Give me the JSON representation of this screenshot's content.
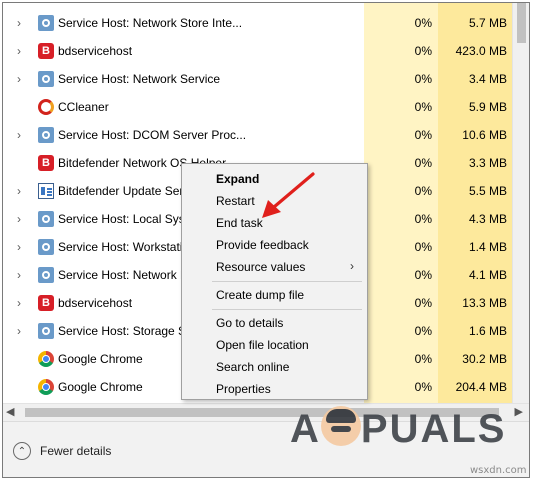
{
  "processes": [
    {
      "name": "Service Host: Network Store Inte...",
      "icon": "service-host-gear-icon",
      "expandable": true,
      "cpu": "0%",
      "memory": "5.7 MB"
    },
    {
      "name": "bdservicehost",
      "icon": "bitdefender-icon",
      "expandable": true,
      "cpu": "0%",
      "memory": "423.0 MB"
    },
    {
      "name": "Service Host: Network Service",
      "icon": "service-host-gear-icon",
      "expandable": true,
      "cpu": "0%",
      "memory": "3.4 MB"
    },
    {
      "name": "CCleaner",
      "icon": "ccleaner-icon",
      "expandable": false,
      "cpu": "0%",
      "memory": "5.9 MB"
    },
    {
      "name": "Service Host: DCOM Server Proc...",
      "icon": "service-host-gear-icon",
      "expandable": true,
      "cpu": "0%",
      "memory": "10.6 MB"
    },
    {
      "name": "Bitdefender Network OS Helper",
      "icon": "bitdefender-icon",
      "expandable": false,
      "cpu": "0%",
      "memory": "3.3 MB"
    },
    {
      "name": "Bitdefender Update Serv",
      "icon": "bitdefender-update-icon",
      "expandable": true,
      "cpu": "0%",
      "memory": "5.5 MB"
    },
    {
      "name": "Service Host: Local Syst",
      "icon": "service-host-gear-icon",
      "expandable": true,
      "cpu": "0%",
      "memory": "4.3 MB"
    },
    {
      "name": "Service Host: Workstatio",
      "icon": "service-host-gear-icon",
      "expandable": true,
      "cpu": "0%",
      "memory": "1.4 MB"
    },
    {
      "name": "Service Host: Network L",
      "icon": "service-host-gear-icon",
      "expandable": true,
      "cpu": "0%",
      "memory": "4.1 MB"
    },
    {
      "name": "bdservicehost",
      "icon": "bitdefender-icon",
      "expandable": true,
      "cpu": "0%",
      "memory": "13.3 MB"
    },
    {
      "name": "Service Host: Storage Se",
      "icon": "service-host-gear-icon",
      "expandable": true,
      "cpu": "0%",
      "memory": "1.6 MB"
    },
    {
      "name": "Google Chrome",
      "icon": "chrome-icon",
      "expandable": false,
      "cpu": "0%",
      "memory": "30.2 MB"
    },
    {
      "name": "Google Chrome",
      "icon": "chrome-icon",
      "expandable": false,
      "cpu": "0%",
      "memory": "204.4 MB"
    }
  ],
  "context_menu": {
    "items": [
      {
        "label": "Expand",
        "bold": true,
        "submenu": false
      },
      {
        "label": "Restart",
        "bold": false,
        "submenu": false
      },
      {
        "label": "End task",
        "bold": false,
        "submenu": false
      },
      {
        "label": "Provide feedback",
        "bold": false,
        "submenu": false
      },
      {
        "label": "Resource values",
        "bold": false,
        "submenu": true
      },
      {
        "label": "Create dump file",
        "bold": false,
        "submenu": false
      },
      {
        "label": "Go to details",
        "bold": false,
        "submenu": false
      },
      {
        "label": "Open file location",
        "bold": false,
        "submenu": false
      },
      {
        "label": "Search online",
        "bold": false,
        "submenu": false
      },
      {
        "label": "Properties",
        "bold": false,
        "submenu": false
      }
    ]
  },
  "footer": {
    "fewer_details_label": "Fewer details"
  },
  "watermark": {
    "text_before": "A",
    "text_after": "PUALS"
  },
  "site_label": "wsxdn.com",
  "colors": {
    "cpu_column": "#fff4c4",
    "memory_column": "#fde99c",
    "annotation_arrow": "#e0201c"
  }
}
